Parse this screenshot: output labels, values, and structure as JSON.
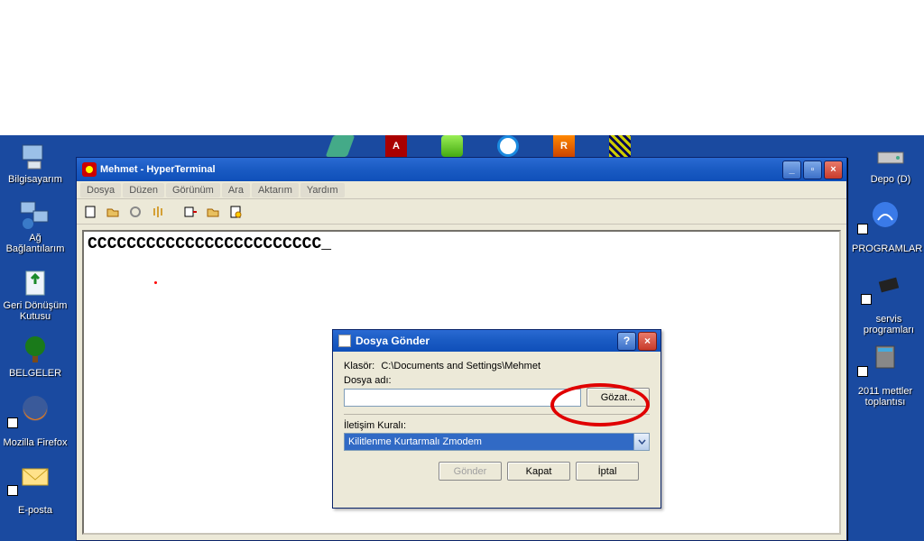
{
  "window": {
    "title": "Mehmet - HyperTerminal",
    "menus": [
      "Dosya",
      "Düzen",
      "Görünüm",
      "Ara",
      "Aktarım",
      "Yardım"
    ],
    "terminal_text": "CCCCCCCCCCCCCCCCCCCCCCCC_"
  },
  "dialog": {
    "title": "Dosya Gönder",
    "folder_label": "Klasör:",
    "folder_path": "C:\\Documents and Settings\\Mehmet",
    "filename_label": "Dosya adı:",
    "filename_value": "",
    "browse_btn": "Gözat...",
    "protocol_label": "İletişim Kuralı:",
    "protocol_value": "Kilitlenme Kurtarmalı Zmodem",
    "send_btn": "Gönder",
    "close_btn": "Kapat",
    "cancel_btn": "İptal"
  },
  "desktop_icons_left": [
    {
      "label": "Bilgisayarım"
    },
    {
      "label": "Ağ Bağlantılarım"
    },
    {
      "label": "Geri Dönüşüm Kutusu"
    },
    {
      "label": "BELGELER"
    },
    {
      "label": "Mozilla Firefox"
    },
    {
      "label": "E-posta"
    }
  ],
  "desktop_icons_right": [
    {
      "label": "Depo (D)"
    },
    {
      "label": "PROGRAMLAR"
    },
    {
      "label": "servis programları"
    },
    {
      "label": "2011 mettler toplantısı"
    }
  ]
}
